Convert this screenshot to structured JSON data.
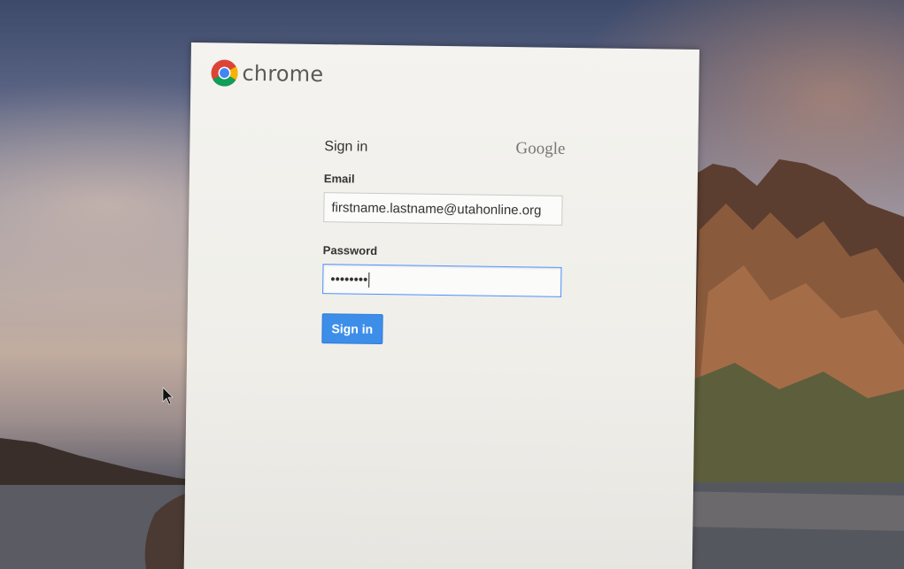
{
  "brand": {
    "logo_icon": "chrome-logo-icon",
    "name": "chrome"
  },
  "form": {
    "title": "Sign in",
    "provider": "Google",
    "email": {
      "label": "Email",
      "value": "firstname.lastname@utahonline.org"
    },
    "password": {
      "label": "Password",
      "value": "••••••••"
    },
    "submit_label": "Sign in"
  },
  "colors": {
    "accent": "#3d8ee8",
    "focus_border": "#4d90fe"
  }
}
